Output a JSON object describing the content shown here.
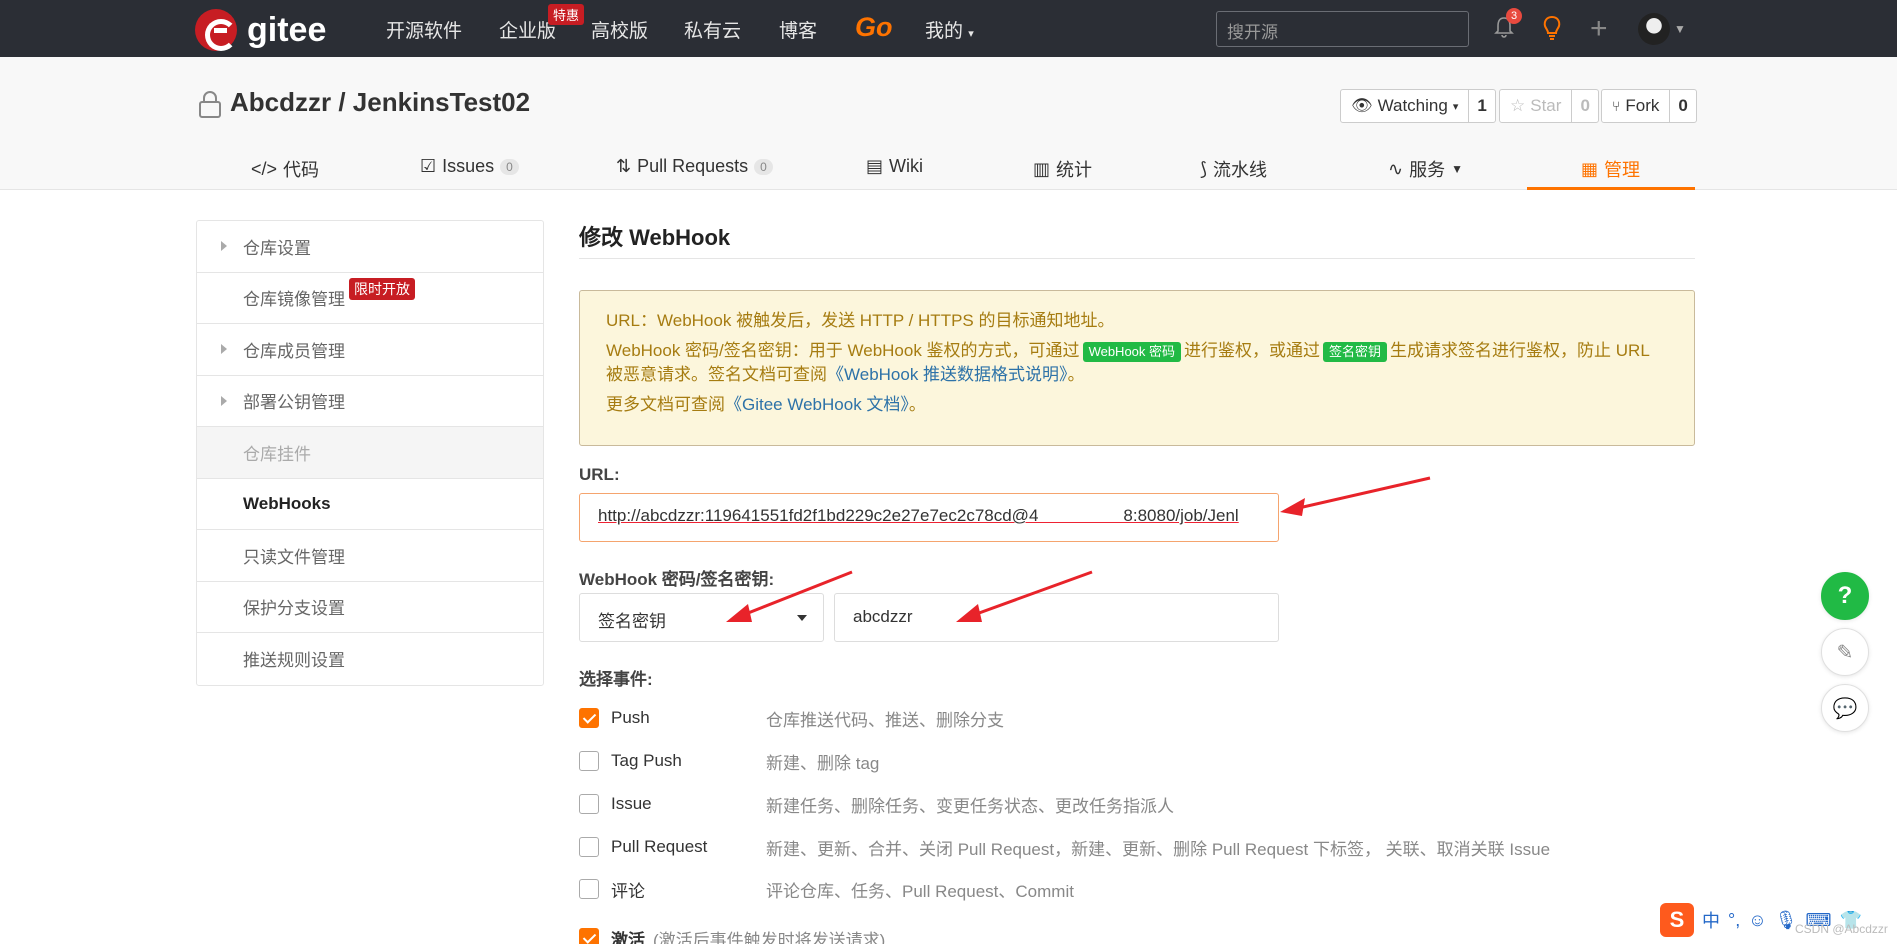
{
  "topnav": {
    "logo_text": "gitee",
    "items": [
      "开源软件",
      "企业版",
      "高校版",
      "私有云",
      "博客"
    ],
    "enterprise_badge": "特惠",
    "go_label": "Go",
    "mine_label": "我的",
    "search_placeholder": "搜开源",
    "notifications_count": "3",
    "brand_color": "#c71d23",
    "accent_color": "#fe7300"
  },
  "repo": {
    "title": "Abcdzzr / JenkinsTest02",
    "watching_label": "Watching",
    "watching_count": "1",
    "star_label": "Star",
    "star_count": "0",
    "fork_label": "Fork",
    "fork_count": "0"
  },
  "tabs": [
    {
      "label": "代码",
      "icon": "code-icon"
    },
    {
      "label": "Issues",
      "count": "0",
      "icon": "issues-icon"
    },
    {
      "label": "Pull Requests",
      "count": "0",
      "icon": "pull-request-icon"
    },
    {
      "label": "Wiki",
      "icon": "book-icon"
    },
    {
      "label": "统计",
      "icon": "bar-chart-icon"
    },
    {
      "label": "流水线",
      "icon": "pipeline-icon"
    },
    {
      "label": "服务",
      "icon": "pulse-icon"
    },
    {
      "label": "管理",
      "icon": "manage-icon",
      "active": true
    }
  ],
  "sidebar": {
    "items": [
      {
        "label": "仓库设置",
        "expandable": true
      },
      {
        "label": "仓库镜像管理",
        "tag": "限时开放"
      },
      {
        "label": "仓库成员管理",
        "expandable": true
      },
      {
        "label": "部署公钥管理",
        "expandable": true
      },
      {
        "label": "仓库挂件",
        "disabled": true
      },
      {
        "label": "WebHooks",
        "current": true
      },
      {
        "label": "只读文件管理"
      },
      {
        "label": "保护分支设置"
      },
      {
        "label": "推送规则设置"
      }
    ]
  },
  "main": {
    "title": "修改 WebHook",
    "notice": {
      "line1": "URL：WebHook 被触发后，发送 HTTP / HTTPS 的目标通知地址。",
      "line2_a": "WebHook 密码/签名密钥：用于 WebHook 鉴权的方式，可通过",
      "pill1": "WebHook 密码",
      "line2_b": "进行鉴权，或通过",
      "pill2": "签名密钥",
      "line2_c": "生成请求签名进行鉴权，防止 URL 被恶意请求。签名文档可查阅",
      "link1": "《WebHook 推送数据格式说明》",
      "line2_d": "。",
      "line3_a": "更多文档可查阅",
      "link2": "《Gitee WebHook 文档》",
      "line3_b": "。"
    },
    "url_label": "URL:",
    "url_value": "http://abcdzzr:119641551fd2f1bd229c2e27e7ec2c78cd@4     8:8080/job/Jenl",
    "secret_label": "WebHook 密码/签名密钥:",
    "secret_type": "签名密钥",
    "secret_value": "abcdzzr",
    "events_label": "选择事件:",
    "events": [
      {
        "name": "Push",
        "desc": "仓库推送代码、推送、删除分支",
        "checked": true
      },
      {
        "name": "Tag Push",
        "desc": "新建、删除 tag",
        "checked": false
      },
      {
        "name": "Issue",
        "desc": "新建任务、删除任务、变更任务状态、更改任务指派人",
        "checked": false
      },
      {
        "name": "Pull Request",
        "desc": "新建、更新、合并、关闭 Pull Request，新建、更新、删除 Pull Request 下标签， 关联、取消关联 Issue",
        "checked": false
      },
      {
        "name": "评论",
        "desc": "评论仓库、任务、Pull Request、Commit",
        "checked": false
      }
    ],
    "activate_label": "激活",
    "activate_desc": "(激活后事件触发时将发送请求)"
  },
  "fab": {
    "help": "?"
  },
  "ime": {
    "label": "中"
  },
  "watermark": "CSDN @Abcdzzr"
}
